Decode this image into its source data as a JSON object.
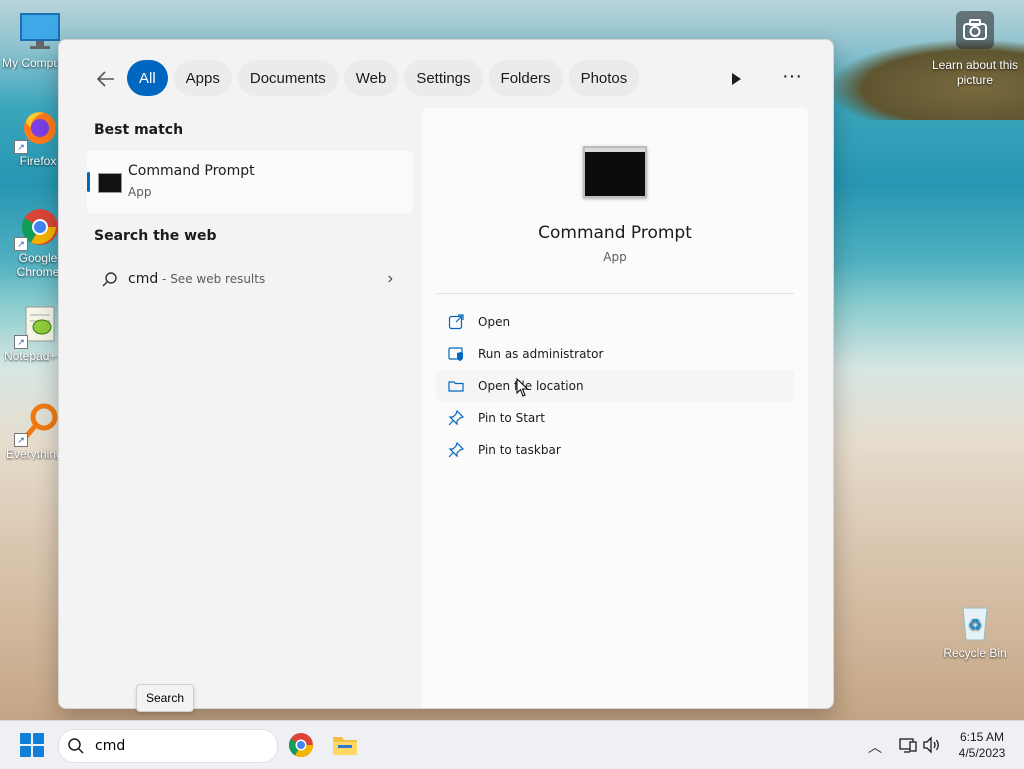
{
  "desktop": {
    "icons": [
      {
        "label": "My Computer"
      },
      {
        "label": "Firefox"
      },
      {
        "label": "Google Chrome"
      },
      {
        "label": "Notepad++"
      },
      {
        "label": "Everything"
      },
      {
        "label": "Recycle Bin"
      }
    ],
    "learn_text": "Learn about this picture"
  },
  "search_panel": {
    "tabs": [
      {
        "label": "All",
        "active": true
      },
      {
        "label": "Apps"
      },
      {
        "label": "Documents"
      },
      {
        "label": "Web"
      },
      {
        "label": "Settings"
      },
      {
        "label": "Folders"
      },
      {
        "label": "Photos"
      }
    ],
    "best_match_heading": "Best match",
    "best_match": {
      "title": "Command Prompt",
      "subtitle": "App"
    },
    "search_web_heading": "Search the web",
    "web_result": {
      "query": "cmd",
      "hint": " - See web results"
    },
    "preview": {
      "title": "Command Prompt",
      "subtitle": "App",
      "actions": [
        {
          "label": "Open",
          "icon": "open-external-icon"
        },
        {
          "label": "Run as administrator",
          "icon": "shield-icon"
        },
        {
          "label": "Open file location",
          "icon": "folder-icon"
        },
        {
          "label": "Pin to Start",
          "icon": "pin-icon"
        },
        {
          "label": "Pin to taskbar",
          "icon": "pin-icon"
        }
      ]
    }
  },
  "tooltip": "Search",
  "taskbar": {
    "search_value": "cmd",
    "time": "6:15 AM",
    "date": "4/5/2023"
  },
  "colors": {
    "accent": "#0067c0"
  }
}
